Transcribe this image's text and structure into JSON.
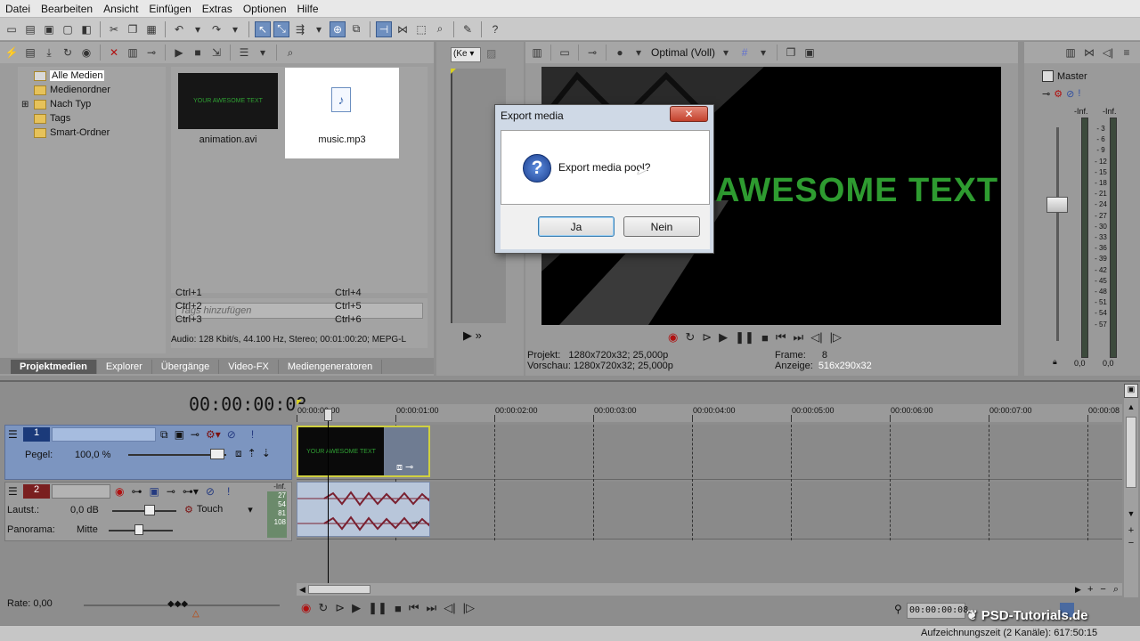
{
  "menu": [
    "Datei",
    "Bearbeiten",
    "Ansicht",
    "Einfügen",
    "Extras",
    "Optionen",
    "Hilfe"
  ],
  "explorer": {
    "tree": [
      "Alle Medien",
      "Medienordner",
      "Nach Typ",
      "Tags",
      "Smart-Ordner"
    ],
    "media": [
      {
        "name": "animation.avi",
        "thumb_text": "YOUR AWESOME TEXT"
      },
      {
        "name": "music.mp3"
      }
    ],
    "tags_placeholder": "Tags hinzufügen",
    "shortcuts": [
      "Ctrl+1",
      "Ctrl+4",
      "Ctrl+2",
      "Ctrl+5",
      "Ctrl+3",
      "Ctrl+6"
    ],
    "info": "Audio: 128 Kbit/s, 44.100 Hz, Stereo; 00:01:00:20; MEPG-L"
  },
  "bottom_tabs": [
    "Projektmedien",
    "Explorer",
    "Übergänge",
    "Video-FX",
    "Mediengeneratoren"
  ],
  "trimmer": {
    "zoom_label": "(Ke"
  },
  "preview": {
    "quality": "Optimal (Voll)",
    "overlay_text": "AWESOME TEXT",
    "projekt_label": "Projekt:",
    "projekt_value": "1280x720x32; 25,000p",
    "vorschau_label": "Vorschau:",
    "vorschau_value": "1280x720x32; 25,000p",
    "frame_label": "Frame:",
    "frame_value": "8",
    "anzeige_label": "Anzeige:",
    "anzeige_value": "516x290x32"
  },
  "dialog": {
    "title": "Export media",
    "message": "Export media pool?",
    "yes": "Ja",
    "no": "Nein"
  },
  "mixer": {
    "title": "Master",
    "left_inf": "-Inf.",
    "right_inf": "-Inf.",
    "scale": [
      "3",
      "6",
      "9",
      "12",
      "15",
      "18",
      "21",
      "24",
      "27",
      "30",
      "33",
      "36",
      "39",
      "42",
      "45",
      "48",
      "51",
      "54",
      "57"
    ],
    "left_val": "0,0",
    "right_val": "0,0"
  },
  "timeline": {
    "timecode": "00:00:00:08",
    "ruler": [
      "00:00:00:00",
      "00:00:01:00",
      "00:00:02:00",
      "00:00:03:00",
      "00:00:04:00",
      "00:00:05:00",
      "00:00:06:00",
      "00:00:07:00",
      "00:00:08"
    ],
    "clip_text": "YOUR AWESOME TEXT",
    "track1": {
      "number": "1",
      "pegel_label": "Pegel:",
      "pegel_value": "100,0 %"
    },
    "track2": {
      "number": "2",
      "lautst_label": "Lautst.:",
      "lautst_value": "0,0 dB",
      "touch": "Touch",
      "panorama_label": "Panorama:",
      "panorama_value": "Mitte",
      "meter": [
        "-Inf.",
        "27",
        "54",
        "81",
        "108"
      ]
    },
    "rate": "Rate: 0,00",
    "bottom_timecode": "00:00:00:08"
  },
  "status": {
    "record_time": "Aufzeichnungszeit (2 Kanäle): 617:50:15",
    "watermark": "PSD-Tutorials.de"
  },
  "colors": {
    "accent": "#3b5c8f",
    "track_blue": "#7c95c0",
    "text_green": "#2fa033",
    "clip_border": "#d0d040"
  }
}
